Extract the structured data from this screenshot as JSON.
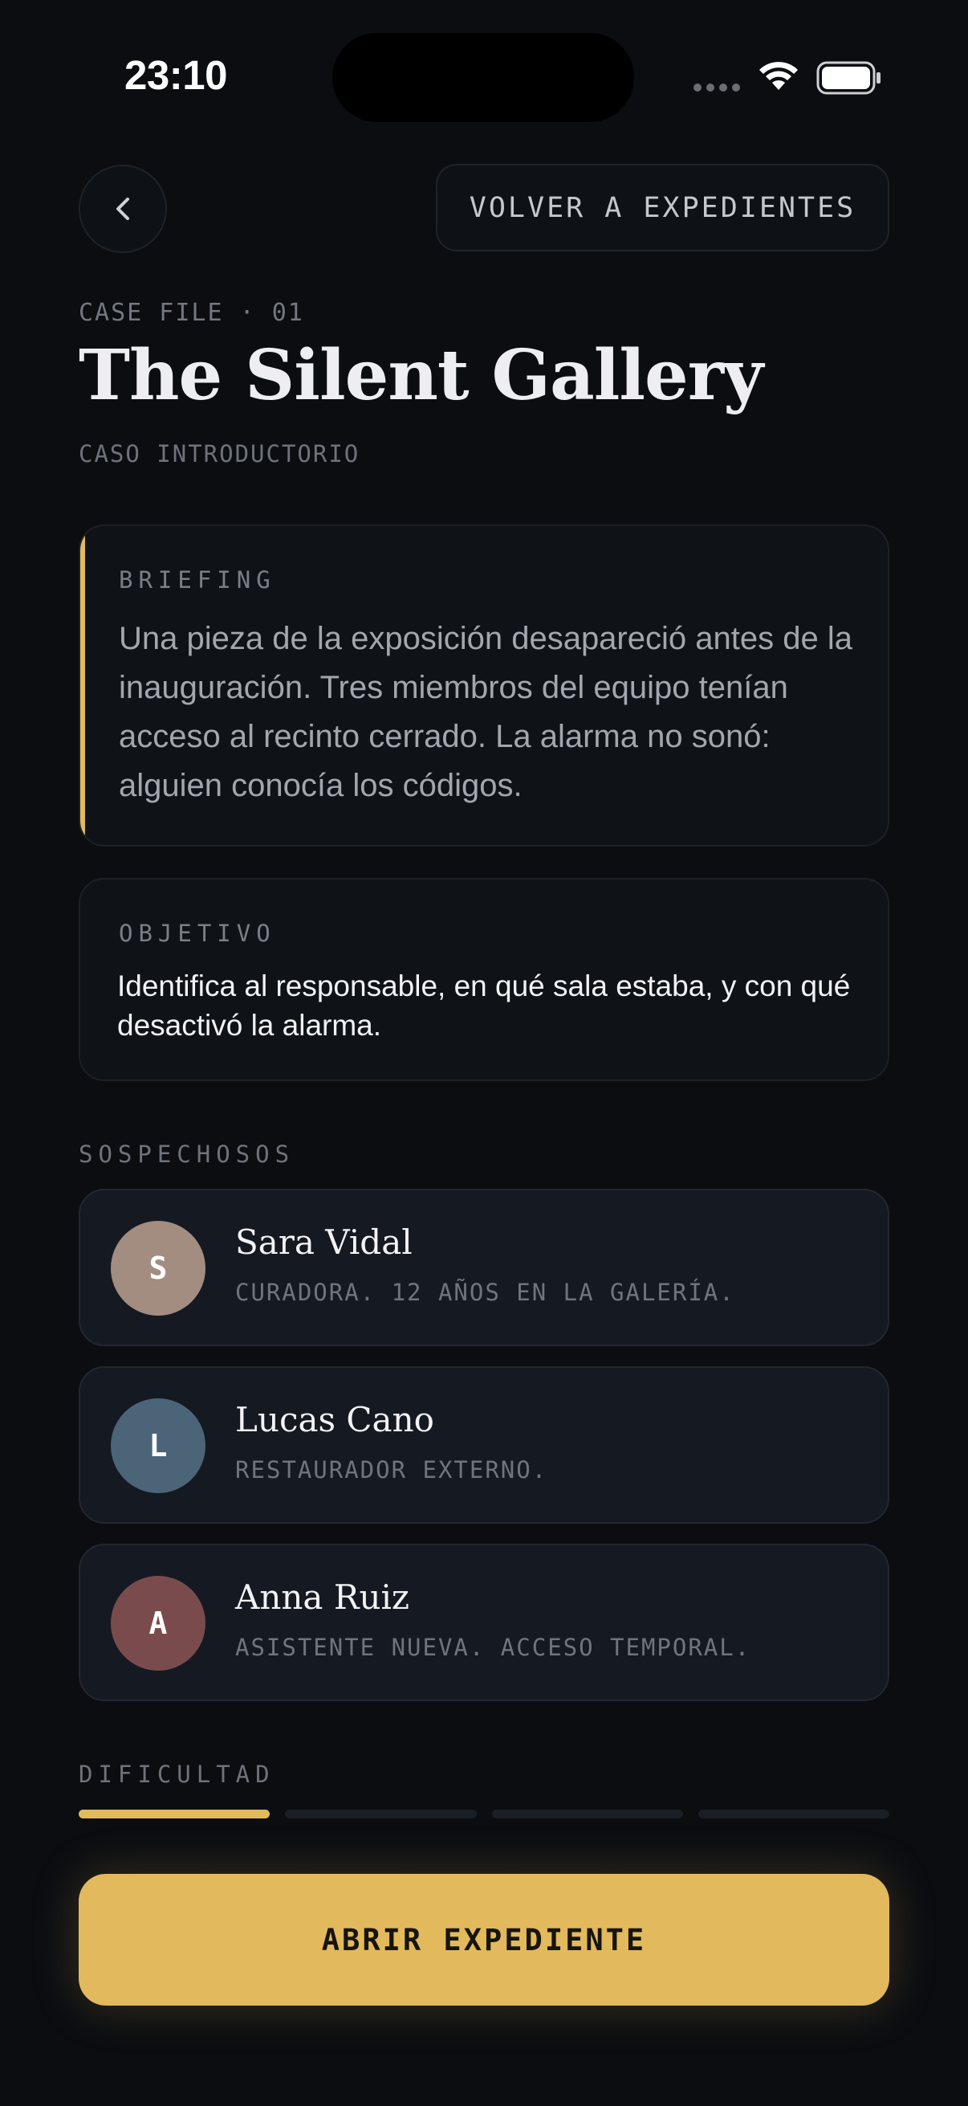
{
  "status_bar": {
    "time": "23:10"
  },
  "header": {
    "back_to_cases_label": "VOLVER A EXPEDIENTES"
  },
  "case": {
    "eyebrow": "CASE FILE · 01",
    "title": "The Silent Gallery",
    "subtitle": "CASO INTRODUCTORIO"
  },
  "briefing": {
    "label": "BRIEFING",
    "text": "Una pieza de la exposición desapareció antes de la inauguración. Tres miembros del equipo tenían acceso al recinto cerrado. La alarma no sonó: alguien conocía los códigos."
  },
  "objective": {
    "label": "OBJETIVO",
    "text": "Identifica al responsable, en qué sala estaba, y con qué desactivó la alarma."
  },
  "suspects": {
    "label": "SOSPECHOSOS",
    "items": [
      {
        "initial": "S",
        "name": "Sara Vidal",
        "description": "CURADORA. 12 AÑOS EN LA GALERÍA.",
        "avatar_color": "#a38c80"
      },
      {
        "initial": "L",
        "name": "Lucas Cano",
        "description": "RESTAURADOR EXTERNO.",
        "avatar_color": "#4b6478"
      },
      {
        "initial": "A",
        "name": "Anna Ruiz",
        "description": "ASISTENTE NUEVA. ACCESO TEMPORAL.",
        "avatar_color": "#7a4b4d"
      }
    ]
  },
  "difficulty": {
    "label": "DIFICULTAD",
    "level": 1,
    "max": 4
  },
  "primary_action": {
    "label": "ABRIR EXPEDIENTE"
  },
  "colors": {
    "accent": "#e2ba5d",
    "background": "#0b0d11"
  }
}
